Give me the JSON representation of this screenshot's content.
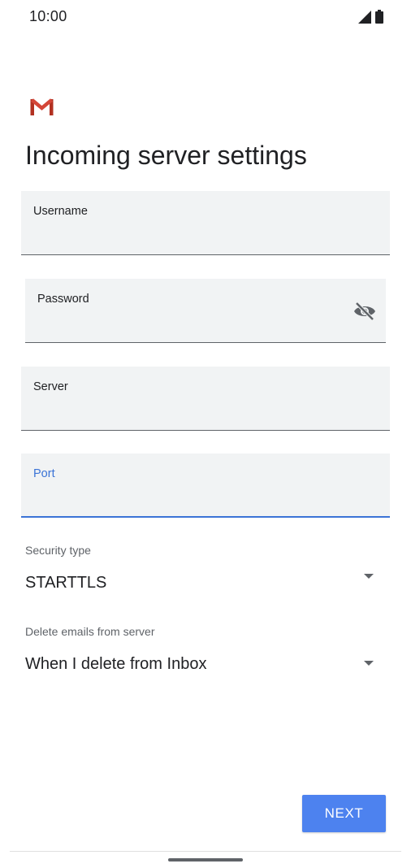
{
  "status_bar": {
    "time": "10:00",
    "signal_icon": "cell-signal-icon",
    "battery_icon": "battery-icon"
  },
  "logo": {
    "icon": "gmail-logo-icon",
    "colors": {
      "red": "#d44638",
      "dark_red": "#b23121"
    }
  },
  "page": {
    "title": "Incoming server settings"
  },
  "fields": {
    "username": {
      "label": "Username",
      "value": ""
    },
    "password": {
      "label": "Password",
      "value": "",
      "toggle_icon": "eye-off-icon"
    },
    "server": {
      "label": "Server",
      "value": ""
    },
    "port": {
      "label": "Port",
      "value": "",
      "focused": true
    }
  },
  "security_type": {
    "label": "Security type",
    "selected": "STARTTLS"
  },
  "delete_emails": {
    "label": "Delete emails from server",
    "selected": "When I delete from Inbox"
  },
  "actions": {
    "next_label": "NEXT"
  },
  "colors": {
    "accent": "#3b73d6",
    "button": "#4d82ef",
    "field_bg": "#f1f3f4",
    "text": "#202124",
    "secondary_text": "#5f6368"
  }
}
